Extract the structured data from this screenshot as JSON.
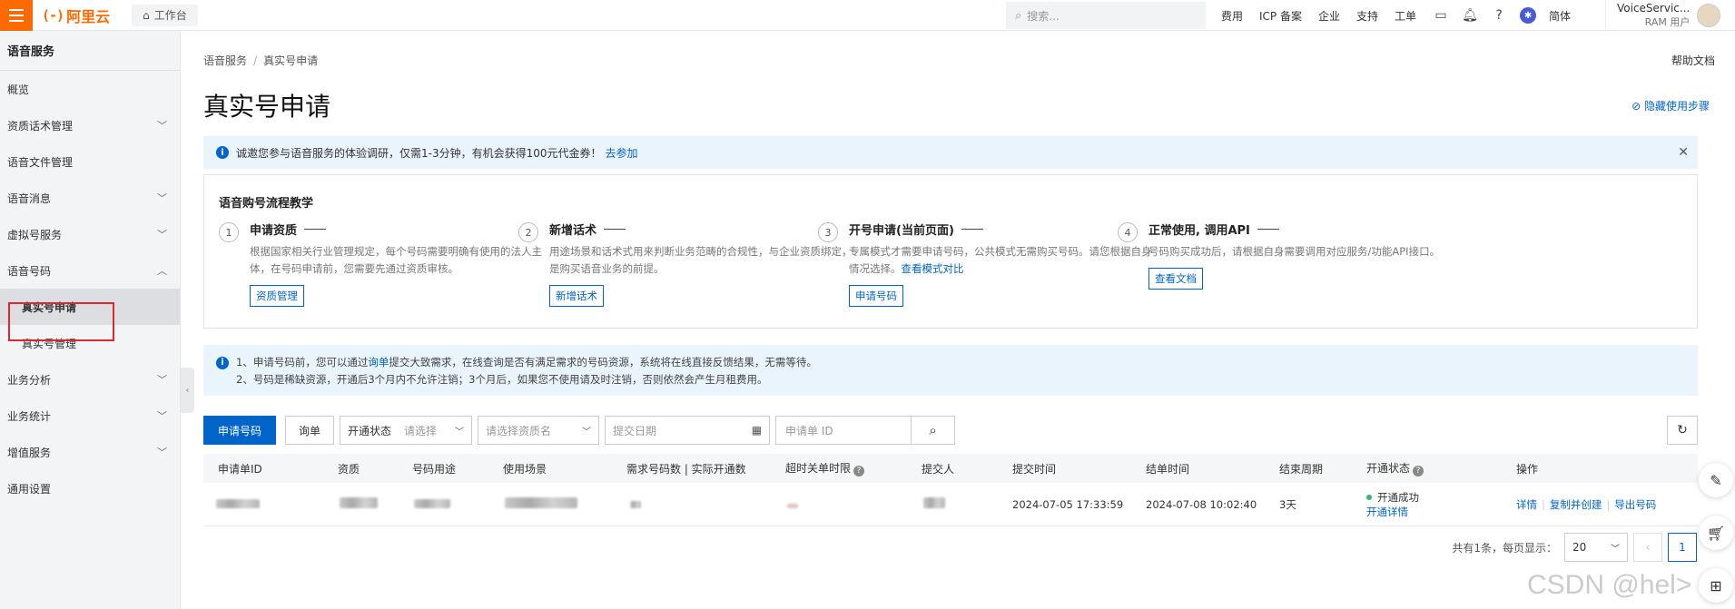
{
  "topbar": {
    "logo_mark": "(-)",
    "logo_text": "阿里云",
    "workbench_label": "工作台",
    "search_placeholder": "搜索...",
    "nav": [
      "费用",
      "ICP 备案",
      "企业",
      "支持",
      "工单"
    ],
    "lang": "简体",
    "account_name": "VoiceServic...",
    "account_type": "RAM 用户"
  },
  "sidebar": {
    "title": "语音服务",
    "items": [
      {
        "label": "概览"
      },
      {
        "label": "资质话术管理"
      },
      {
        "label": "语音文件管理"
      },
      {
        "label": "语音消息"
      },
      {
        "label": "虚拟号服务"
      },
      {
        "label": "语音号码"
      },
      {
        "label": "真实号申请"
      },
      {
        "label": "真实号管理"
      },
      {
        "label": "业务分析"
      },
      {
        "label": "业务统计"
      },
      {
        "label": "增值服务"
      },
      {
        "label": "通用设置"
      }
    ]
  },
  "breadcrumb": [
    "语音服务",
    "真实号申请"
  ],
  "help_doc": "帮助文档",
  "page_title": "真实号申请",
  "hide_steps": "隐藏使用步骤",
  "notice": {
    "text": "诚邀您参与语音服务的体验调研，仅需1-3分钟，有机会获得100元代金券！",
    "link": "去参加"
  },
  "tutorial": {
    "title": "语音购号流程教学",
    "steps": [
      {
        "num": "1",
        "title": "申请资质",
        "desc": "根据国家相关行业管理规定，每个号码需要明确有使用的法人主体，在号码申请前，您需要先通过资质审核。",
        "button": "资质管理"
      },
      {
        "num": "2",
        "title": "新增话术",
        "desc": "用途场景和话术式用来判断业务范畴的合规性，与企业资质绑定，是购买语音业务的前提。",
        "button": "新增话术"
      },
      {
        "num": "3",
        "title": "开号申请(当前页面)",
        "desc": "专属模式才需要申请号码，公共模式无需购买号码。请您根据自身情况选择。",
        "desc_link": "查看模式对比",
        "button": "申请号码"
      },
      {
        "num": "4",
        "title": "正常使用, 调用API",
        "desc": "号码购买成功后，请根据自身需要调用对应服务/功能API接口。",
        "button": "查看文档"
      }
    ]
  },
  "notice2": {
    "line1_pre": "1、申请号码前，您可以通过",
    "line1_link": "询单",
    "line1_post": "提交大致需求，在线查询是否有满足需求的号码资源，系统将在线直接反馈结果，无需等待。",
    "line2": "2、号码是稀缺资源，开通后3个月内不允许注销；3个月后，如果您不使用请及时注销，否则依然会产生月租费用。"
  },
  "toolbar": {
    "apply_btn": "申请号码",
    "inquiry_btn": "询单",
    "status_label": "开通状态",
    "status_placeholder": "请选择",
    "resource_placeholder": "请选择资质名",
    "date_placeholder": "提交日期",
    "id_placeholder": "申请单 ID"
  },
  "table": {
    "headers": [
      "申请单ID",
      "资质",
      "号码用途",
      "使用场景",
      "需求号码数 | 实际开通数",
      "超时关单时限",
      "提交人",
      "提交时间",
      "结单时间",
      "结束周期",
      "开通状态",
      "操作"
    ],
    "rows": [
      {
        "submit_time": "2024-07-05 17:33:59",
        "close_time": "2024-07-08 10:02:40",
        "period": "3天",
        "status": "开通成功",
        "status_link": "开通详情",
        "ops": [
          "详情",
          "复制并创建",
          "导出号码"
        ]
      }
    ]
  },
  "pager": {
    "total_text": "共有1条，每页显示：",
    "page_size": "20",
    "current_page": "1"
  },
  "watermark": "CSDN @hel>"
}
